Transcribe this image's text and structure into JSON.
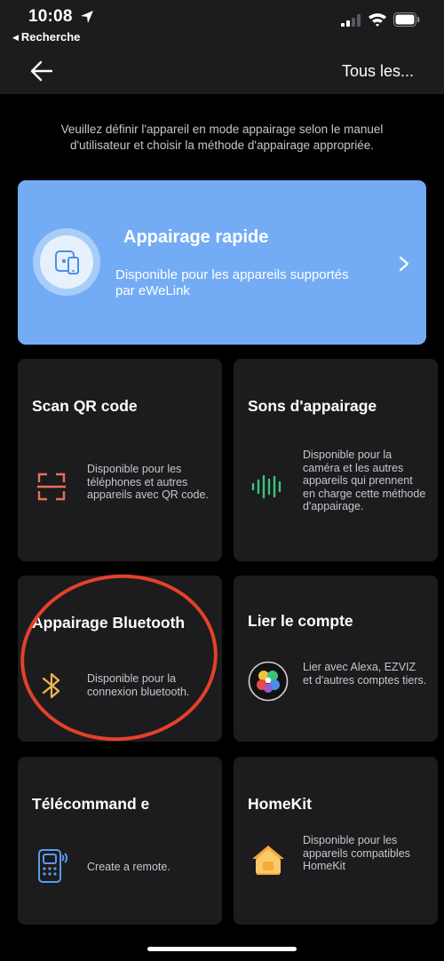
{
  "status_bar": {
    "time": "10:08",
    "back_app_label": "Recherche",
    "icons": [
      "location-arrow-icon",
      "cellular-signal-icon",
      "wifi-icon",
      "battery-icon"
    ]
  },
  "navbar": {
    "back_icon": "back-arrow-icon",
    "right_label": "Tous les..."
  },
  "instructions": "Veuillez définir l'appareil en mode appairage selon le manuel d'utilisateur et choisir la méthode d'appairage appropriée.",
  "quick_pairing": {
    "title": "Appairage rapide",
    "description": "Disponible pour les appareils supportés par eWeLink",
    "icon": "quick-pair-devices-icon",
    "chevron": "chevron-right-icon",
    "color": "#73acf5"
  },
  "cards": [
    {
      "title": "Scan QR code",
      "description": "Disponible pour les téléphones et autres appareils avec QR code.",
      "icon": "qr-scan-icon"
    },
    {
      "title": "Sons d'appairage",
      "description": "Disponible pour la caméra et les autres appareils qui prennent en charge cette méthode d'appairage.",
      "icon": "sound-wave-icon"
    },
    {
      "title": "Appairage Bluetooth",
      "description": "Disponible pour la connexion bluetooth.",
      "icon": "bluetooth-icon"
    },
    {
      "title": "Lier le compte",
      "description": "Lier avec Alexa, EZVIZ et d'autres comptes tiers.",
      "icon": "link-account-icon"
    },
    {
      "title": "Télécommand e",
      "description": "Create a remote.",
      "icon": "remote-control-icon"
    },
    {
      "title": "HomeKit",
      "description": "Disponible pour les appareils compatibles HomeKit",
      "icon": "homekit-icon"
    }
  ],
  "colors": {
    "background": "#000000",
    "card": "#1c1c1e",
    "accent_blue": "#73acf5",
    "highlight_red": "#e5402b",
    "qr_icon": "#e8715a",
    "sound_icon": "#3ec17a",
    "bluetooth_icon": "#f1b748",
    "remote_icon": "#5b9bf0",
    "homekit_icon": "#f5a93a"
  }
}
